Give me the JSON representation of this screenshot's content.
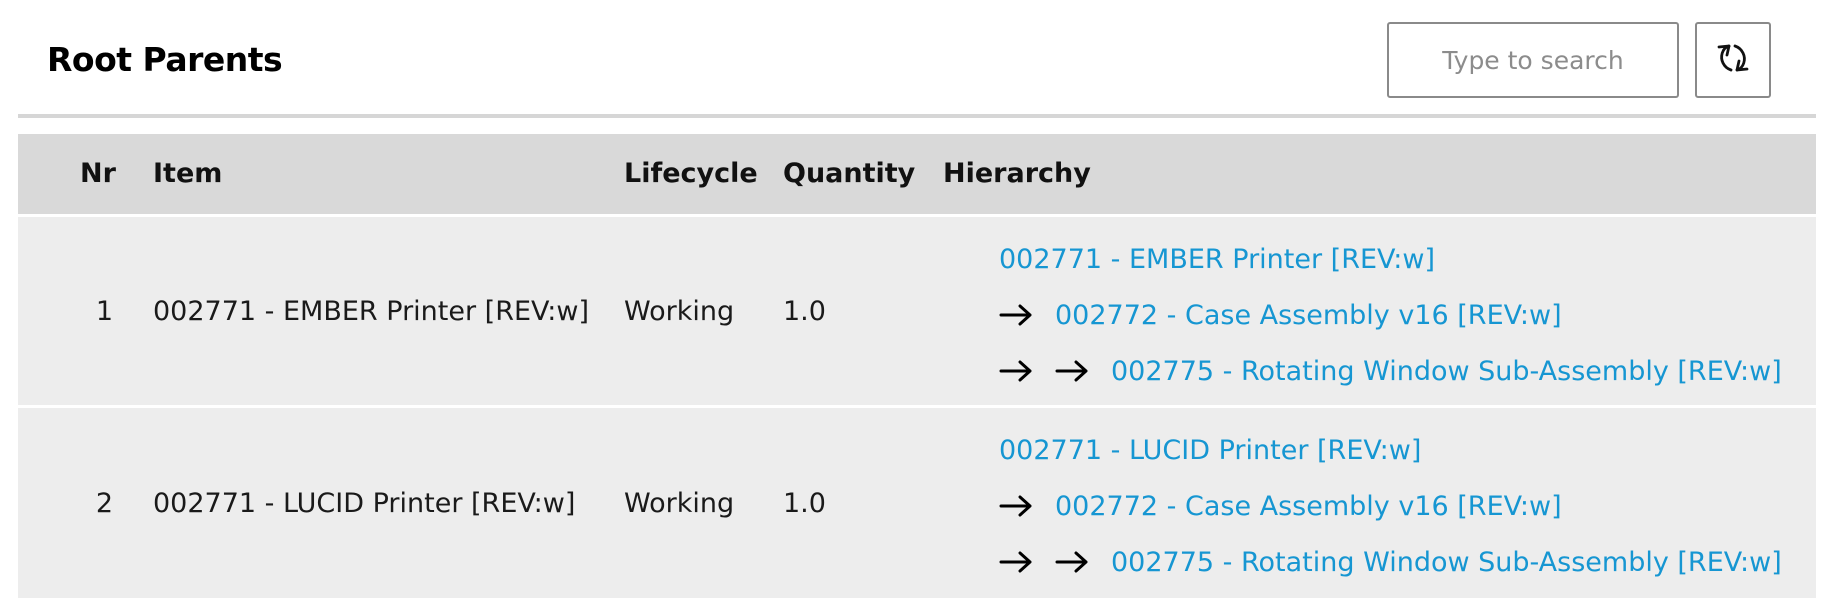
{
  "header": {
    "title": "Root Parents",
    "search_placeholder": "Type to search",
    "refresh_icon": "refresh-icon"
  },
  "table": {
    "columns": [
      "Nr",
      "Item",
      "Lifecycle",
      "Quantity",
      "Hierarchy"
    ],
    "rows": [
      {
        "nr": "1",
        "item": "002771 - EMBER Printer [REV:w]",
        "lifecycle": "Working",
        "quantity": "1.0",
        "hierarchy": [
          "002771 - EMBER Printer [REV:w]",
          "002772 - Case Assembly v16 [REV:w]",
          "002775 - Rotating Window Sub-Assembly [REV:w]"
        ]
      },
      {
        "nr": "2",
        "item": "002771 - LUCID Printer [REV:w]",
        "lifecycle": "Working",
        "quantity": "1.0",
        "hierarchy": [
          "002771 - LUCID Printer [REV:w]",
          "002772 - Case Assembly v16 [REV:w]",
          "002775 - Rotating Window Sub-Assembly [REV:w]"
        ]
      }
    ]
  },
  "colors": {
    "link": "#1696d2",
    "header_bg": "#d9d9d9",
    "row_bg": "#ededed"
  }
}
